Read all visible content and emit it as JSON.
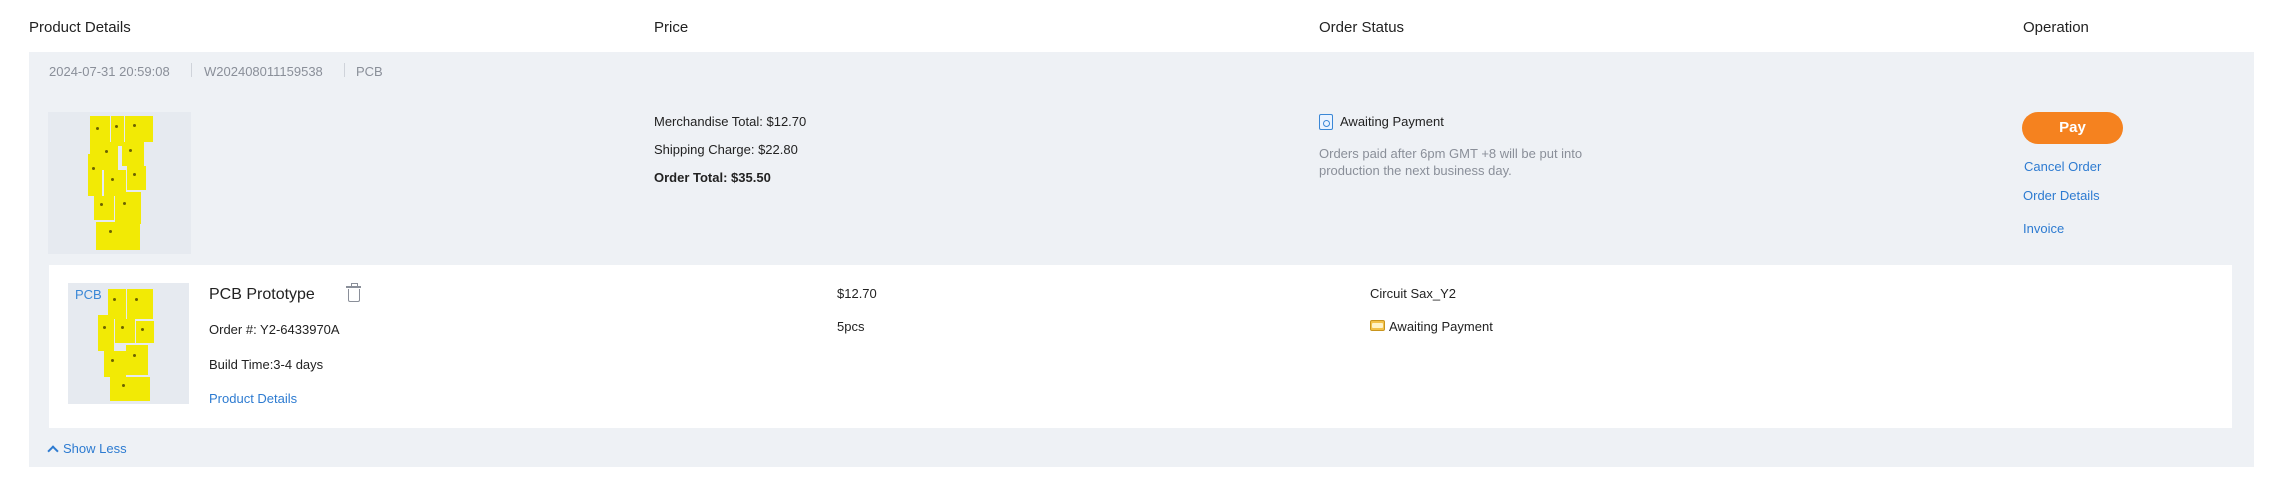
{
  "columns": {
    "product_details": "Product Details",
    "price": "Price",
    "order_status": "Order Status",
    "operation": "Operation"
  },
  "order": {
    "datetime": "2024-07-31 20:59:08",
    "order_no": "W202408011159538",
    "type": "PCB",
    "merchandise_total": "Merchandise Total: $12.70",
    "shipping_charge": "Shipping Charge: $22.80",
    "order_total": "Order Total: $35.50",
    "status": "Awaiting Payment",
    "status_note": "Orders paid after 6pm GMT +8 will be put into production the next business day.",
    "actions": {
      "pay": "Pay",
      "cancel": "Cancel Order",
      "details": "Order Details",
      "invoice": "Invoice"
    }
  },
  "item": {
    "tag": "PCB",
    "title": "PCB Prototype",
    "order_number": "Order #: Y2-6433970A",
    "build_time": "Build Time:3-4 days",
    "details_link": "Product Details",
    "price": "$12.70",
    "quantity": "5pcs",
    "name": "Circuit Sax_Y2",
    "status": "Awaiting Payment"
  },
  "show_less": "Show Less",
  "icons": {
    "status": "document-search-icon",
    "item_status": "folder-icon",
    "delete": "trash-icon",
    "collapse": "chevron-up-icon"
  },
  "colors": {
    "accent": "#f5821f",
    "link": "#2d7bd1",
    "card_bg": "#eef1f5",
    "pcb": "#f2ea05"
  }
}
